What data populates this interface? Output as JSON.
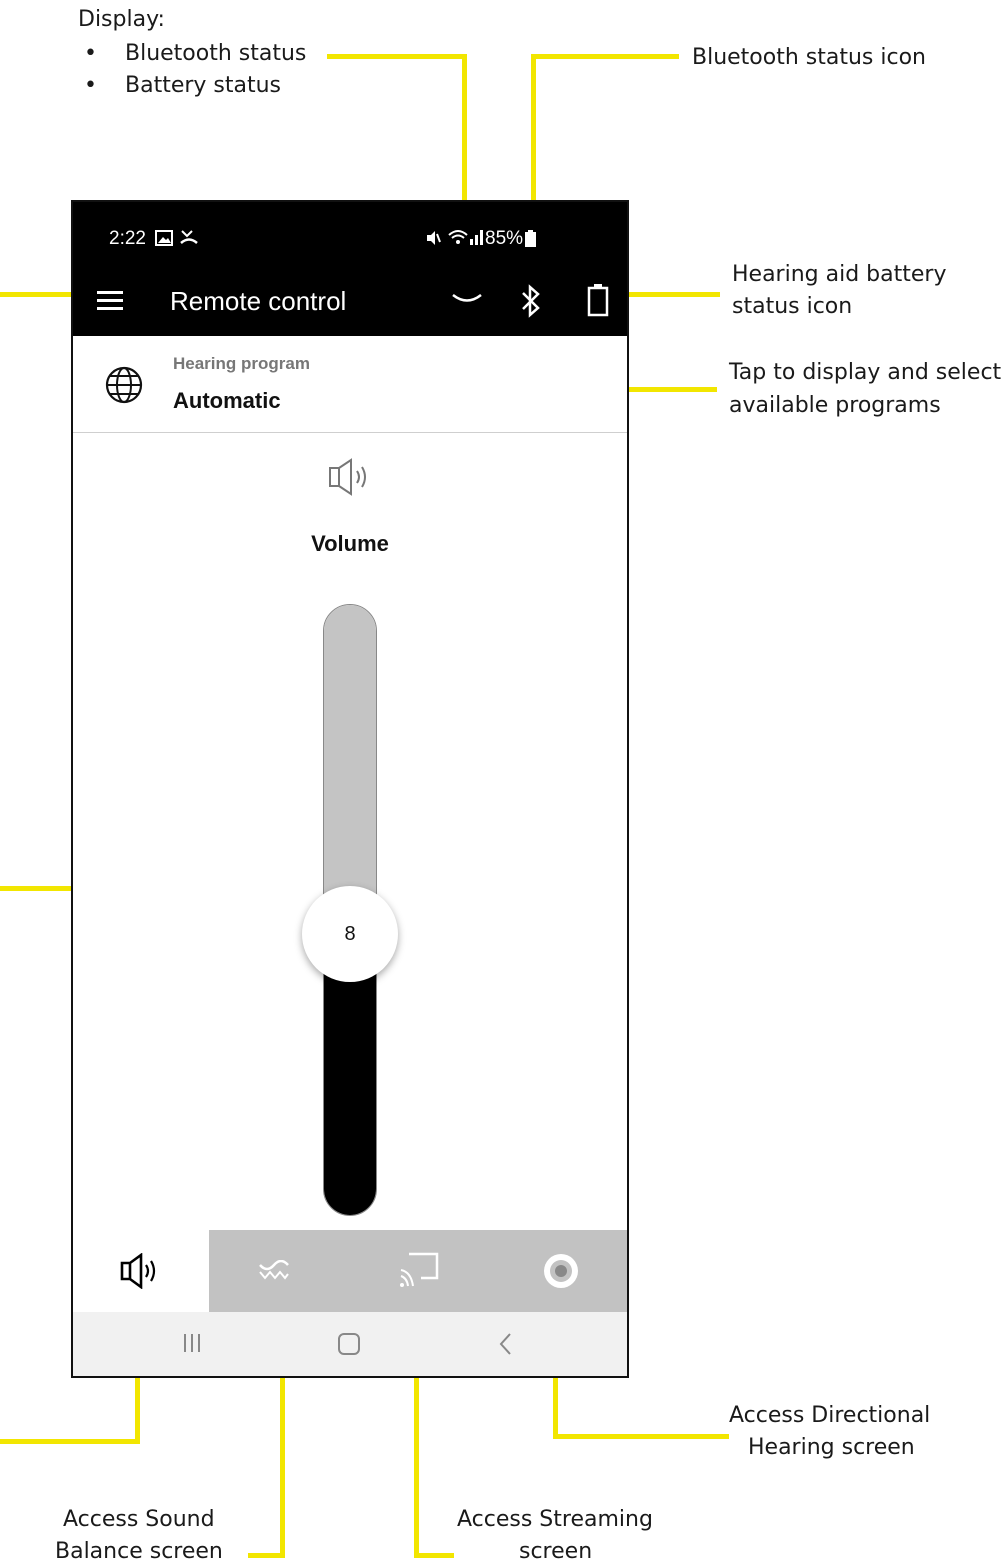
{
  "annotations": {
    "display_heading": "Display:",
    "display_bullets": [
      "Bluetooth status",
      "Battery status"
    ],
    "bluetooth_icon": "Bluetooth status icon",
    "battery_icon_line1": "Hearing aid battery",
    "battery_icon_line2": "status icon",
    "programs_line1": "Tap to display and select",
    "programs_line2": "available programs",
    "directional_line1": "Access Directional",
    "directional_line2": "Hearing screen",
    "sound_balance_line1": "Access Sound",
    "sound_balance_line2": "Balance screen",
    "streaming_line1": "Access Streaming",
    "streaming_line2": "screen",
    "bullet_char": "•"
  },
  "status_bar": {
    "time": "2:22",
    "battery_percent": "85%"
  },
  "app_bar": {
    "title": "Remote control"
  },
  "program": {
    "label": "Hearing program",
    "value": "Automatic"
  },
  "volume": {
    "label": "Volume",
    "value": "8",
    "level_fraction": 0.46
  },
  "tabs": [
    {
      "name": "volume",
      "icon": "speaker-icon",
      "active": true
    },
    {
      "name": "sound-balance",
      "icon": "wave-icon",
      "active": false
    },
    {
      "name": "streaming",
      "icon": "cast-icon",
      "active": false
    },
    {
      "name": "directional",
      "icon": "target-icon",
      "active": false
    }
  ],
  "colors": {
    "callout": "#f2e600",
    "bar": "#000000",
    "track": "#c4c4c4"
  }
}
